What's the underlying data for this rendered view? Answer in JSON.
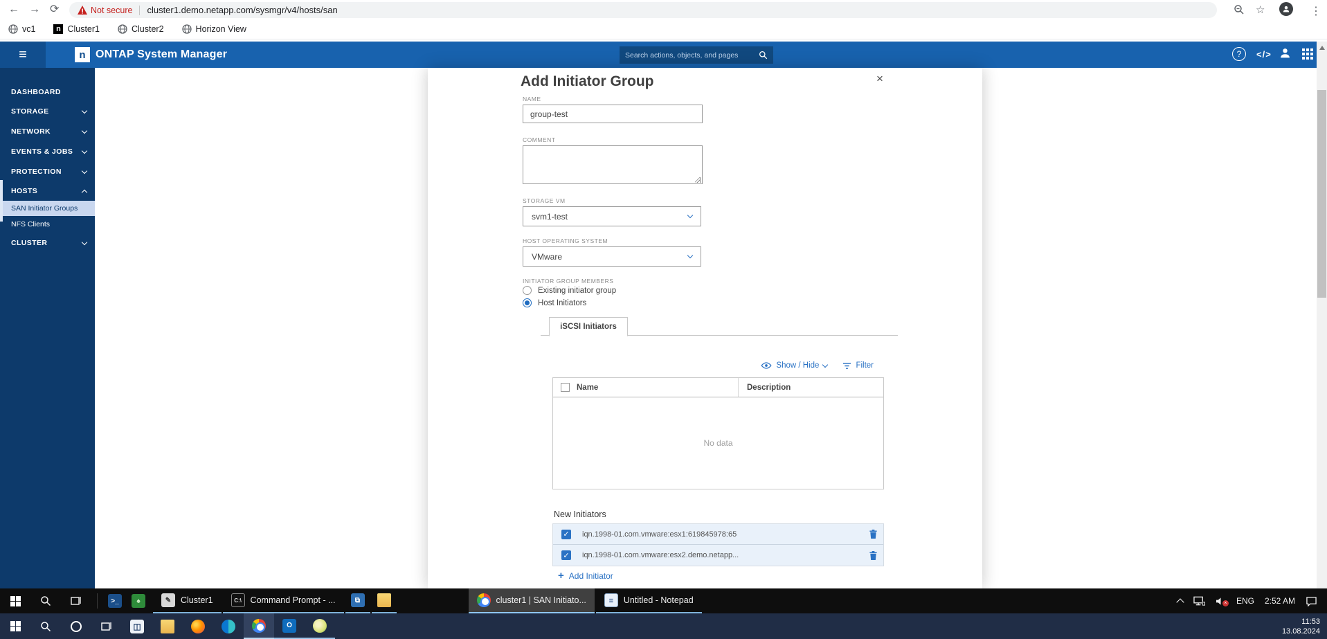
{
  "glyphs": {
    "back": "←",
    "forward": "→",
    "reload": "⟳",
    "menu": "⋮",
    "star": "☆",
    "hamburger": "≡",
    "code": "</>",
    "help": "?",
    "close": "×",
    "plus": "+",
    "check": "✓",
    "warning": "!",
    "netapp_n": "n",
    "ps": ">_",
    "cmd": "C:\\",
    "vbox": "◫",
    "outlook": "O",
    "notepad": "≣"
  },
  "colors": {
    "header_blue": "#1862ae",
    "sidebar_navy": "#0d3a6b",
    "accent_blue": "#2a72c4",
    "warning_red": "#c5221f",
    "selected_item_bg": "#c9d7ef",
    "row_highlight": "#e9f1fa"
  },
  "browser": {
    "security_warning": "Not secure",
    "url": "cluster1.demo.netapp.com/sysmgr/v4/hosts/san",
    "bookmarks": [
      {
        "label": "vc1"
      },
      {
        "label": "Cluster1"
      },
      {
        "label": "Cluster2"
      },
      {
        "label": "Horizon View"
      }
    ]
  },
  "app_header": {
    "title": "ONTAP System Manager",
    "search_placeholder": "Search actions, objects, and pages"
  },
  "sidebar": {
    "items": [
      {
        "label": "DASHBOARD"
      },
      {
        "label": "STORAGE"
      },
      {
        "label": "NETWORK"
      },
      {
        "label": "EVENTS & JOBS"
      },
      {
        "label": "PROTECTION"
      },
      {
        "label": "HOSTS"
      },
      {
        "label": "CLUSTER"
      }
    ],
    "hosts_children": [
      {
        "label": "SAN Initiator Groups"
      },
      {
        "label": "NFS Clients"
      }
    ]
  },
  "dialog": {
    "title": "Add Initiator Group",
    "fields": {
      "name_label": "NAME",
      "name_value": "group-test",
      "comment_label": "COMMENT",
      "storage_vm_label": "STORAGE VM",
      "storage_vm_value": "svm1-test",
      "host_os_label": "HOST OPERATING SYSTEM",
      "host_os_value": "VMware"
    },
    "members": {
      "label": "INITIATOR GROUP MEMBERS",
      "option_existing": "Existing initiator group",
      "option_host": "Host Initiators",
      "selected": "Host Initiators"
    },
    "tab_label": "iSCSI Initiators",
    "table": {
      "show_hide_label": "Show / Hide",
      "filter_label": "Filter",
      "columns": [
        "Name",
        "Description"
      ],
      "empty_text": "No data"
    },
    "new_initiators": {
      "label": "New Initiators",
      "items": [
        "iqn.1998-01.com.vmware:esx1:619845978:65",
        "iqn.1998-01.com.vmware:esx2.demo.netapp..."
      ],
      "add_label": "Add Initiator"
    }
  },
  "taskbar_inner": {
    "buttons": [
      {
        "label": "Cluster1"
      },
      {
        "label": "Command Prompt - ..."
      },
      {
        "label": "cluster1 | SAN Initiato..."
      },
      {
        "label": "Untitled - Notepad"
      }
    ],
    "tray": {
      "lang": "ENG",
      "time": "2:52 AM"
    }
  },
  "taskbar_outer": {
    "clock": {
      "time": "11:53",
      "date": "13.08.2024"
    }
  }
}
